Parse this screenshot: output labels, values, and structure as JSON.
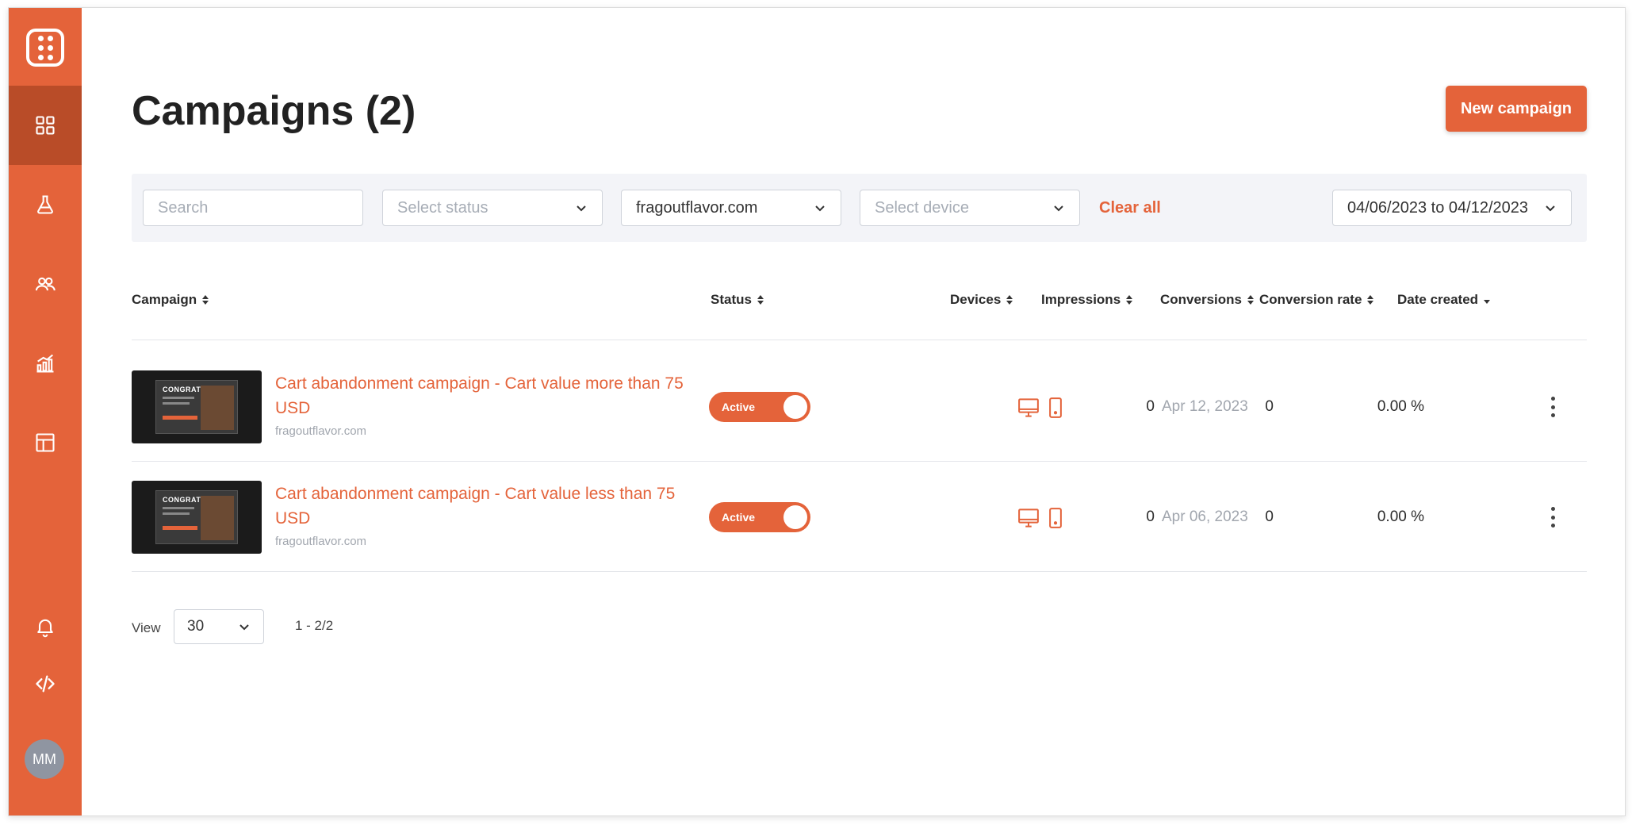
{
  "sidebar": {
    "nav": [
      {
        "icon": "dashboard-grid-icon",
        "active": true
      },
      {
        "icon": "flask-icon",
        "active": false
      },
      {
        "icon": "users-icon",
        "active": false
      },
      {
        "icon": "analytics-chart-icon",
        "active": false
      },
      {
        "icon": "layout-template-icon",
        "active": false
      }
    ],
    "bottom": [
      {
        "icon": "bell-icon"
      },
      {
        "icon": "code-icon"
      }
    ],
    "avatar_initials": "MM"
  },
  "header": {
    "title": "Campaigns (2)",
    "new_button": "New campaign"
  },
  "filters": {
    "search_placeholder": "Search",
    "status_placeholder": "Select status",
    "domain_value": "fragoutflavor.com",
    "device_placeholder": "Select device",
    "clear_all": "Clear all",
    "date_range": "04/06/2023 to 04/12/2023"
  },
  "table": {
    "columns": {
      "campaign": "Campaign",
      "status": "Status",
      "devices": "Devices",
      "impressions": "Impressions",
      "conversions": "Conversions",
      "conversion_rate": "Conversion rate",
      "date_created": "Date created"
    },
    "rows": [
      {
        "thumb_text": "CONGRATS!",
        "title": "Cart abandonment campaign - Cart value more than 75 USD",
        "domain": "fragoutflavor.com",
        "status": "Active",
        "impressions": "0",
        "conversions": "0",
        "conversion_rate": "0.00 %",
        "date_created": "Apr 12, 2023"
      },
      {
        "thumb_text": "CONGRATS!",
        "title": "Cart abandonment campaign - Cart value less than 75 USD",
        "domain": "fragoutflavor.com",
        "status": "Active",
        "impressions": "0",
        "conversions": "0",
        "conversion_rate": "0.00 %",
        "date_created": "Apr 06, 2023"
      }
    ]
  },
  "pagination": {
    "view_label": "View",
    "per_page": "30",
    "range": "1 - 2/2"
  },
  "colors": {
    "brand": "#e4633a",
    "brand_dark": "#b94c28"
  }
}
